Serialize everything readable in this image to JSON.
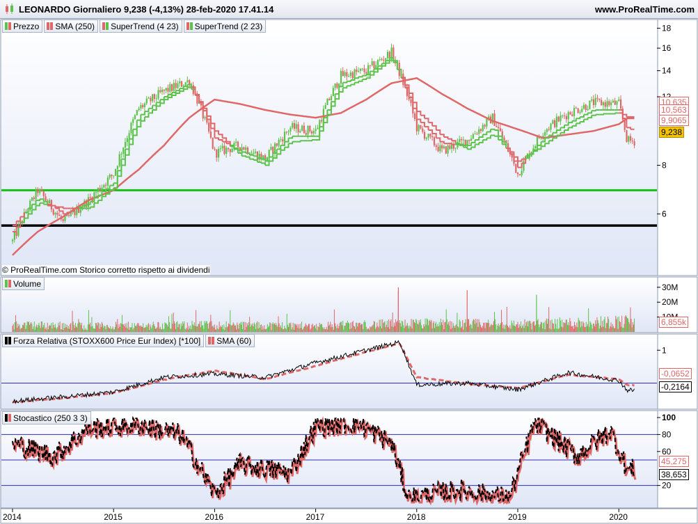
{
  "header": {
    "title": "LEONARDO Giornaliero 9,238 (-4,13%) 28-feb-2020 17.41.14",
    "site": "www.ProRealTime.com"
  },
  "price_panel": {
    "legend": [
      {
        "label": "Prezzo",
        "up": "#5cc34a",
        "down": "#e06767"
      },
      {
        "label": "SMA (250)",
        "up": "#e06767",
        "down": "#e06767"
      },
      {
        "label": "SuperTrend (4 23)",
        "up": "#e06767",
        "down": "#5cc34a"
      },
      {
        "label": "SuperTrend (2 23)",
        "up": "#e06767",
        "down": "#5cc34a"
      }
    ],
    "note": "© ProRealTime.com  Storico corretto rispetto ai dividendi",
    "ticks": [
      "18",
      "16",
      "14",
      "12",
      "8",
      "6"
    ],
    "labels": [
      {
        "text": "10,635",
        "style": "outline-red"
      },
      {
        "text": "10,563",
        "style": "outline-red"
      },
      {
        "text": "9,9065",
        "style": "outline-red"
      },
      {
        "text": "9,238",
        "style": "filled-gold"
      }
    ]
  },
  "volume_panel": {
    "legend": [
      {
        "label": "Volume",
        "up": "#5cc34a",
        "down": "#e06767"
      }
    ],
    "ticks": [
      "30M",
      "20M",
      "10M"
    ],
    "labels": [
      {
        "text": "6,855k",
        "style": "outline-red"
      }
    ]
  },
  "rs_panel": {
    "legend": [
      {
        "label": "Forza Relativa (STOXX600 Price Eur Index) [*100]",
        "up": "#000000",
        "down": "#000000"
      },
      {
        "label": "SMA (60)",
        "up": "#e06767",
        "down": "#e06767"
      }
    ],
    "ticks": [
      "1"
    ],
    "labels": [
      {
        "text": "-0,0652",
        "style": "outline-red"
      },
      {
        "text": "-0,2164",
        "style": "outline-black"
      }
    ]
  },
  "stoch_panel": {
    "legend": [
      {
        "label": "Stocastico (250 3 3)",
        "up": "#000000",
        "down": "#e06767"
      }
    ],
    "ticks": [
      "100",
      "80",
      "60",
      "20"
    ],
    "labels": [
      {
        "text": "45,275",
        "style": "outline-red"
      },
      {
        "text": "38,653",
        "style": "outline-black"
      }
    ]
  },
  "x_axis": {
    "labels": [
      "2014",
      "2015",
      "2016",
      "2017",
      "2018",
      "2019",
      "2020"
    ]
  },
  "colors": {
    "up": "#5cc34a",
    "down": "#e06767",
    "sma": "#e06767",
    "green_line": "#16c016",
    "black_line": "#000000",
    "panel_bg_top": "#ffffff",
    "panel_bg_bottom": "#dfe6f6",
    "grid_line": "#2d2db4"
  },
  "chart_data": [
    {
      "type": "line",
      "title": "LEONARDO Giornaliero",
      "x": [
        "2014-01",
        "2014-04",
        "2014-07",
        "2014-10",
        "2015-01",
        "2015-04",
        "2015-07",
        "2015-10",
        "2016-01",
        "2016-04",
        "2016-07",
        "2016-10",
        "2017-01",
        "2017-04",
        "2017-07",
        "2017-10",
        "2018-01",
        "2018-04",
        "2018-07",
        "2018-10",
        "2019-01",
        "2019-04",
        "2019-07",
        "2019-10",
        "2020-01",
        "2020-02"
      ],
      "series": [
        {
          "name": "Prezzo",
          "values": [
            5.1,
            6.9,
            5.7,
            6.5,
            7.6,
            11.2,
            12.4,
            13.2,
            8.6,
            9.0,
            8.3,
            10.0,
            9.8,
            13.6,
            14.0,
            15.6,
            10.0,
            8.7,
            9.3,
            10.6,
            7.6,
            9.8,
            10.9,
            11.6,
            11.5,
            9.238
          ]
        },
        {
          "name": "SMA (250)",
          "values": [
            4.7,
            5.4,
            5.9,
            6.5,
            6.9,
            7.8,
            9.0,
            10.6,
            11.8,
            11.5,
            11.1,
            10.8,
            10.6,
            10.9,
            11.8,
            13.0,
            13.4,
            12.2,
            11.2,
            10.4,
            9.9,
            9.4,
            9.6,
            9.8,
            10.2,
            10.563
          ]
        },
        {
          "name": "SuperTrend (4 23)",
          "values": [
            5.4,
            6.4,
            6.2,
            6.2,
            7.0,
            10.3,
            11.8,
            12.8,
            9.8,
            8.5,
            8.0,
            9.2,
            9.3,
            12.6,
            13.4,
            15.0,
            11.0,
            9.5,
            8.8,
            9.6,
            8.2,
            9.0,
            10.0,
            10.8,
            10.9,
            10.635
          ]
        },
        {
          "name": "SuperTrend (2 23)",
          "values": [
            5.6,
            6.6,
            6.0,
            6.4,
            7.2,
            10.7,
            12.0,
            13.0,
            9.4,
            8.7,
            8.2,
            9.5,
            9.5,
            13.0,
            13.7,
            15.2,
            10.5,
            9.1,
            9.0,
            10.0,
            7.9,
            9.3,
            10.3,
            11.1,
            11.1,
            9.9065
          ]
        }
      ],
      "y_scale": "log",
      "ylim": [
        4.2,
        18.8
      ],
      "hlines": [
        6.9,
        5.6
      ]
    },
    {
      "type": "bar",
      "title": "Volume",
      "x": [
        "2014",
        "2015",
        "2016",
        "2017",
        "2018",
        "2019",
        "2020"
      ],
      "series": [
        {
          "name": "Volume",
          "values": [
            4.5,
            4.0,
            4.5,
            4.0,
            5.5,
            5.0,
            6.855
          ]
        }
      ],
      "peaks_M": [
        {
          "x": "2017-11",
          "value": 30
        },
        {
          "x": "2017-11",
          "value": 27
        },
        {
          "x": "2018-07",
          "value": 28
        },
        {
          "x": "2019-03",
          "value": 25
        }
      ],
      "ylim": [
        0,
        36
      ]
    },
    {
      "type": "line",
      "title": "Forza Relativa (STOXX600 Price Eur Index) [*100]",
      "x": [
        "2014-01",
        "2014-07",
        "2015-01",
        "2015-07",
        "2016-01",
        "2016-07",
        "2017-01",
        "2017-07",
        "2017-11",
        "2018-01",
        "2018-07",
        "2019-01",
        "2019-07",
        "2020-01",
        "2020-02"
      ],
      "series": [
        {
          "name": "Forza Relativa",
          "values": [
            -0.55,
            -0.42,
            -0.27,
            0.18,
            0.28,
            0.17,
            0.62,
            1.0,
            1.25,
            -0.05,
            0.0,
            -0.2,
            0.32,
            0.08,
            -0.2164
          ]
        },
        {
          "name": "SMA (60)",
          "values": [
            -0.58,
            -0.46,
            -0.3,
            0.1,
            0.38,
            0.12,
            0.52,
            0.95,
            1.2,
            0.18,
            -0.02,
            -0.15,
            0.25,
            0.12,
            -0.0652
          ]
        }
      ],
      "ylim": [
        -0.75,
        1.45
      ]
    },
    {
      "type": "line",
      "title": "Stocastico (250 3 3)",
      "x": [
        "2014-01",
        "2014-06",
        "2014-10",
        "2015-04",
        "2015-09",
        "2016-01",
        "2016-04",
        "2016-10",
        "2017-01",
        "2017-06",
        "2017-10",
        "2017-12",
        "2018-06",
        "2018-12",
        "2019-03",
        "2019-08",
        "2019-12",
        "2020-02"
      ],
      "series": [
        {
          "name": "%K",
          "values": [
            70,
            55,
            88,
            92,
            80,
            10,
            45,
            35,
            90,
            94,
            70,
            5,
            15,
            5,
            95,
            55,
            85,
            38.653
          ]
        },
        {
          "name": "%D",
          "values": [
            72,
            58,
            86,
            90,
            82,
            12,
            42,
            38,
            88,
            93,
            72,
            8,
            14,
            8,
            92,
            58,
            83,
            45.275
          ]
        }
      ],
      "hlines": [
        80,
        50,
        20
      ],
      "ylim": [
        0,
        100
      ]
    }
  ]
}
